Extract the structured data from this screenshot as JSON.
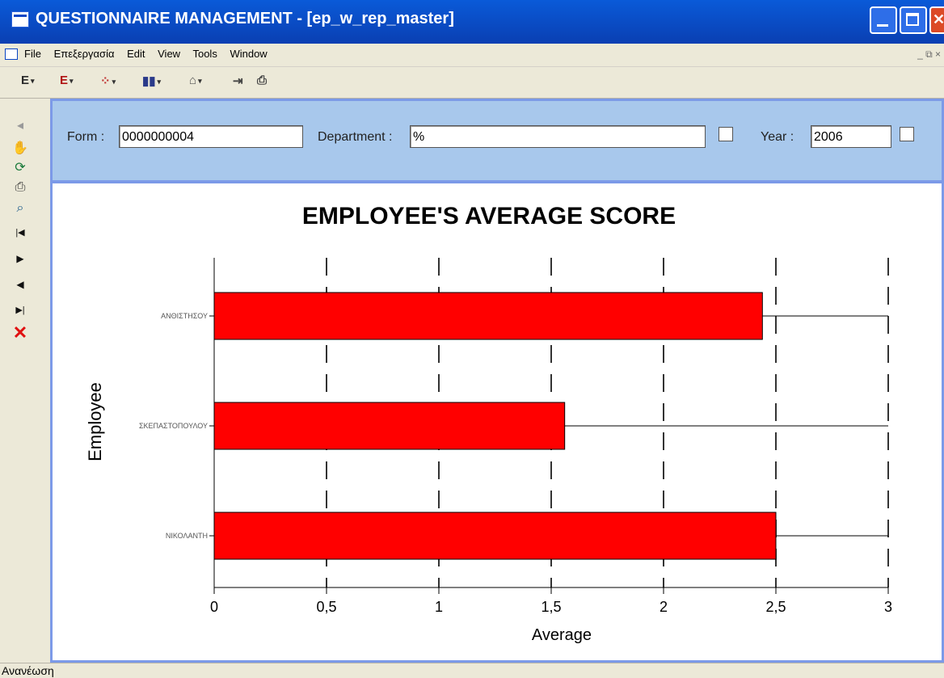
{
  "window": {
    "title": "QUESTIONNAIRE MANAGEMENT - [ep_w_rep_master]"
  },
  "menu": {
    "items": [
      "File",
      "Επεξεργασία",
      "Edit",
      "View",
      "Tools",
      "Window"
    ],
    "mdi_controls": "_ ⧉ ×"
  },
  "toolbar": {
    "buttons": [
      {
        "label": "E",
        "icon": "text-e-icon"
      },
      {
        "label": "E",
        "icon": "text-e-red-icon"
      },
      {
        "label": "",
        "icon": "grid-icon"
      },
      {
        "label": "",
        "icon": "bar-chart-icon"
      },
      {
        "label": "",
        "icon": "building-icon"
      },
      {
        "label": "",
        "icon": "exit-icon"
      },
      {
        "label": "",
        "icon": "print-icon"
      }
    ]
  },
  "sidebar": {
    "buttons": [
      {
        "icon": "back-icon",
        "glyph": "◂"
      },
      {
        "icon": "hand-icon",
        "glyph": "✋"
      },
      {
        "icon": "refresh-icon",
        "glyph": "⟳"
      },
      {
        "icon": "print-icon",
        "glyph": "⎙"
      },
      {
        "icon": "preview-icon",
        "glyph": "⌕"
      },
      {
        "icon": "first-record-icon",
        "glyph": "|◀"
      },
      {
        "icon": "next-record-icon",
        "glyph": "▶"
      },
      {
        "icon": "previous-record-icon",
        "glyph": "◀"
      },
      {
        "icon": "last-record-icon",
        "glyph": "▶|"
      },
      {
        "icon": "delete-icon",
        "glyph": "✕"
      }
    ]
  },
  "filter": {
    "form_label": "Form :",
    "form_value": "0000000004",
    "department_label": "Department :",
    "department_value": "%",
    "year_label": "Year :",
    "year_value": "2006"
  },
  "chart_data": {
    "type": "bar",
    "orientation": "horizontal",
    "title": "EMPLOYEE'S AVERAGE SCORE",
    "xlabel": "Average",
    "ylabel": "Employee",
    "categories": [
      "ΑΝΘΙΣΤΗΣΟΥ",
      "ΣΚΕΠΑΣΤΟΠΟΥΛΟΥ",
      "ΝΙΚΟΛΑΝΤΗ"
    ],
    "values": [
      2.44,
      1.56,
      2.5
    ],
    "xlim": [
      0,
      3
    ],
    "xticks": [
      "0",
      "0,5",
      "1",
      "1,5",
      "2",
      "2,5",
      "3"
    ],
    "bar_color": "#ff0000",
    "grid": "dashed vertical"
  },
  "status": {
    "text": "Ανανέωση"
  }
}
